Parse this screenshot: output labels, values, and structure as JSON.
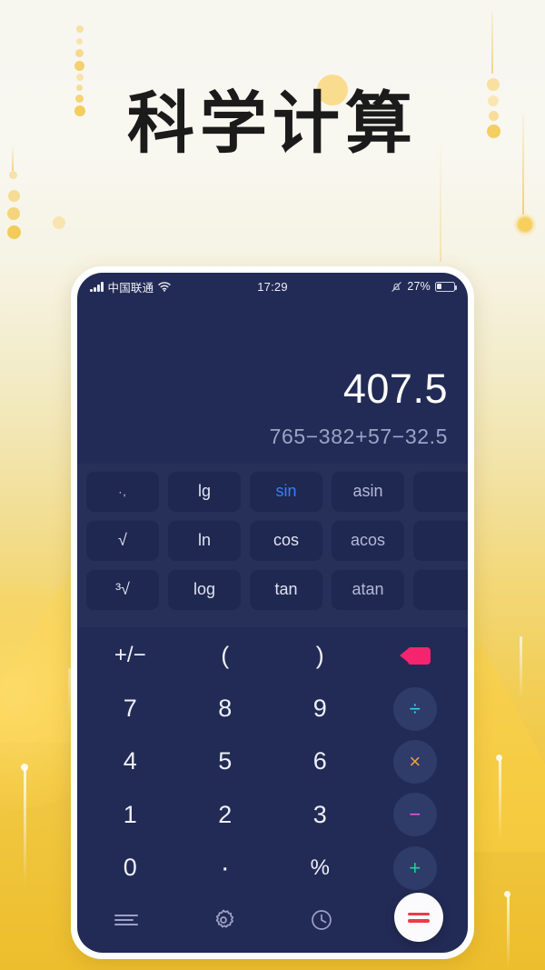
{
  "page": {
    "title": "科学计算",
    "background": {
      "top_color": "#f7f6ef",
      "bottom_color": "#edbe2c",
      "accent_dot_color": "#f5d572"
    }
  },
  "phone": {
    "frame_color": "#ffffff",
    "screen_color": "#222b55"
  },
  "status_bar": {
    "carrier": "中国联通",
    "signal_icon": "signal-bars-icon",
    "wifi_icon": "wifi-icon",
    "time": "17:29",
    "mute_icon": "bell-muted-icon",
    "battery_percent": "27%",
    "battery_icon": "battery-icon",
    "battery_level": 27
  },
  "display": {
    "result": "407.5",
    "expression": "765−382+57−32.5",
    "result_color": "#ffffff",
    "expression_color": "#9aa4c7"
  },
  "function_pad": {
    "background": "#263059",
    "active_color": "#3b7ff5",
    "rows": [
      [
        {
          "label": "·,",
          "state": "normal",
          "name": "fn-comma"
        },
        {
          "label": "lg",
          "state": "normal",
          "name": "fn-lg"
        },
        {
          "label": "sin",
          "state": "active",
          "name": "fn-sin"
        },
        {
          "label": "asin",
          "state": "dim",
          "name": "fn-asin"
        },
        {
          "label": "",
          "state": "cut",
          "name": "fn-hidden-1"
        }
      ],
      [
        {
          "label": "√",
          "state": "normal",
          "name": "fn-sqrt"
        },
        {
          "label": "ln",
          "state": "normal",
          "name": "fn-ln"
        },
        {
          "label": "cos",
          "state": "normal",
          "name": "fn-cos"
        },
        {
          "label": "acos",
          "state": "dim",
          "name": "fn-acos"
        },
        {
          "label": "",
          "state": "cut",
          "name": "fn-hidden-2"
        }
      ],
      [
        {
          "label": "³√",
          "state": "normal",
          "name": "fn-cbrt"
        },
        {
          "label": "log",
          "state": "normal",
          "name": "fn-log"
        },
        {
          "label": "tan",
          "state": "normal",
          "name": "fn-tan"
        },
        {
          "label": "atan",
          "state": "dim",
          "name": "fn-atan"
        },
        {
          "label": "",
          "state": "cut",
          "name": "fn-hidden-3"
        }
      ]
    ]
  },
  "keypad": {
    "rows": [
      [
        "+/−",
        "(",
        ")",
        "backspace"
      ],
      [
        "7",
        "8",
        "9",
        "÷"
      ],
      [
        "4",
        "5",
        "6",
        "×"
      ],
      [
        "1",
        "2",
        "3",
        "−"
      ],
      [
        "0",
        "·",
        "%",
        "+"
      ]
    ],
    "operator_colors": {
      "divide": "#2fd6e8",
      "multiply": "#f0a040",
      "subtract": "#e35ae0",
      "add": "#23cf8e",
      "backspace": "#f4246e"
    },
    "labels": {
      "sign": "+/−",
      "open_paren": "(",
      "close_paren": ")",
      "backspace": "backspace-icon",
      "k7": "7",
      "k8": "8",
      "k9": "9",
      "k4": "4",
      "k5": "5",
      "k6": "6",
      "k1": "1",
      "k2": "2",
      "k3": "3",
      "k0": "0",
      "decimal": "·",
      "percent": "%",
      "divide": "÷",
      "multiply": "×",
      "subtract": "−",
      "add": "+"
    }
  },
  "bottom_bar": {
    "items": [
      {
        "name": "menu-icon",
        "label": "menu"
      },
      {
        "name": "gear-icon",
        "label": "settings"
      },
      {
        "name": "clock-icon",
        "label": "history"
      },
      {
        "name": "equals-button",
        "label": "="
      }
    ],
    "equals_color": "#ef3b46",
    "icon_color": "#9aa3c6"
  }
}
